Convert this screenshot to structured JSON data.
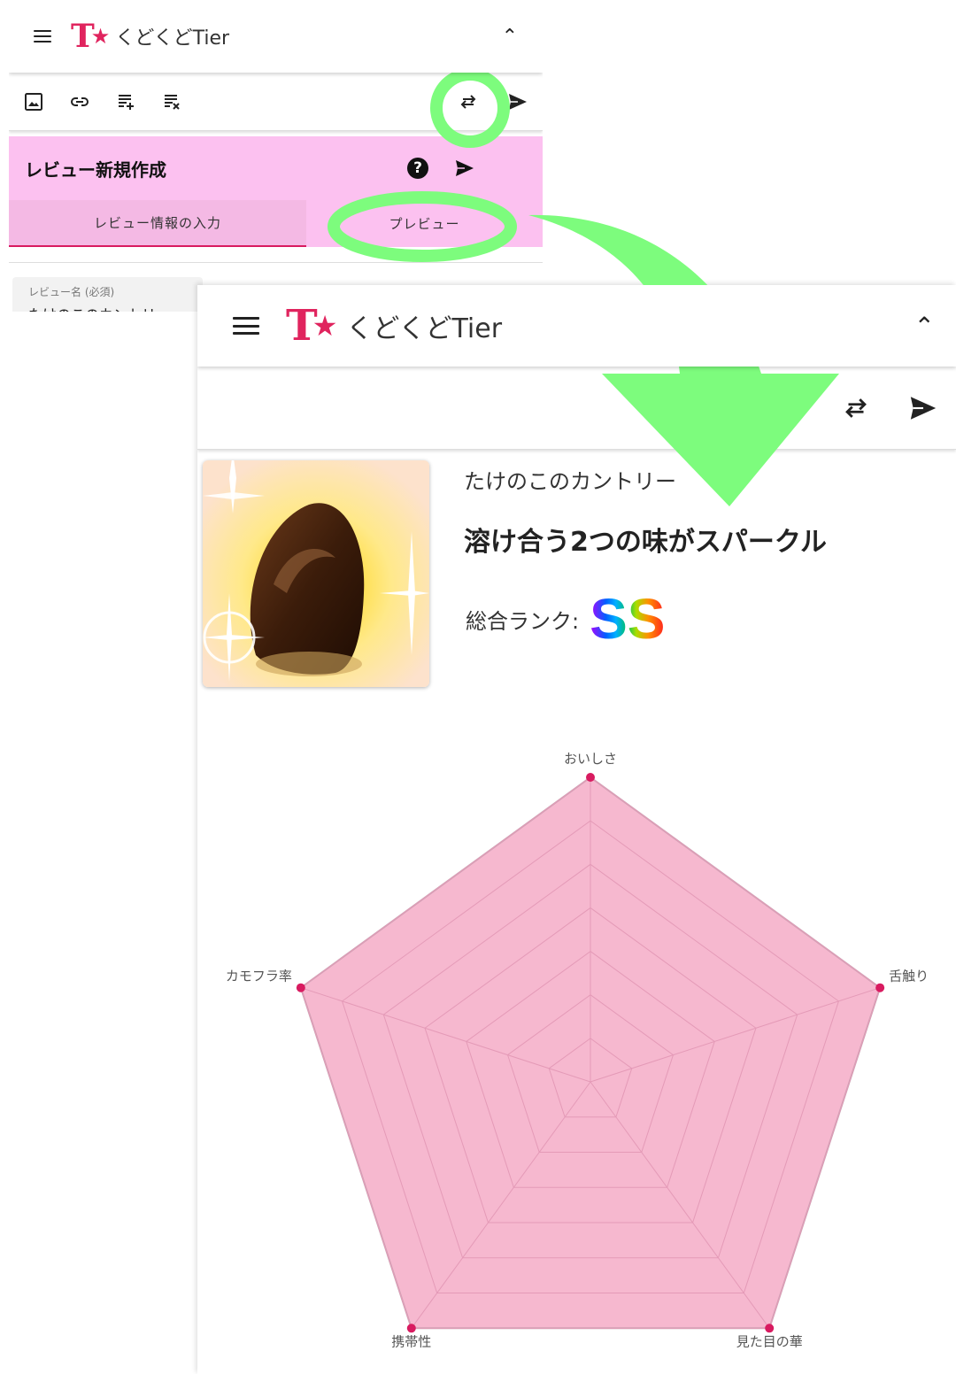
{
  "app": {
    "name": "くどくどTier",
    "logo_t": "T",
    "logo_star": "★"
  },
  "editor": {
    "review_title": "レビュー新規作成",
    "help_icon": "?",
    "tabs": [
      {
        "label": "レビュー情報の入力",
        "active": true
      },
      {
        "label": "プレビュー",
        "active": false
      }
    ],
    "field_label": "レビュー名 (必須)",
    "field_value": "たけのこのカントリー",
    "toolbar_icons": [
      "image-icon",
      "link-icon",
      "note-add-icon",
      "note-remove-icon",
      "swap-icon",
      "send-icon"
    ]
  },
  "preview": {
    "product_name": "たけのこのカントリー",
    "catchphrase": "溶け合う2つの味がスパークル",
    "rank_label": "総合ランク:",
    "rank_value": "SS"
  },
  "colors": {
    "accent": "#e0245e",
    "header_pink": "#fcc1f0",
    "tab_pink": "#f4b9e4",
    "radar_fill": "#f6b8cf",
    "radar_point": "#d81b60",
    "annotation_green": "#7dfc7d"
  },
  "chart_data": {
    "type": "radar",
    "categories": [
      "おいしさ",
      "舌触り",
      "見た目の華",
      "携帯性",
      "カモフラ率"
    ],
    "series": [
      {
        "values": [
          7,
          7,
          7,
          7,
          7
        ]
      }
    ],
    "rlim": [
      0,
      7
    ],
    "grid": true
  }
}
